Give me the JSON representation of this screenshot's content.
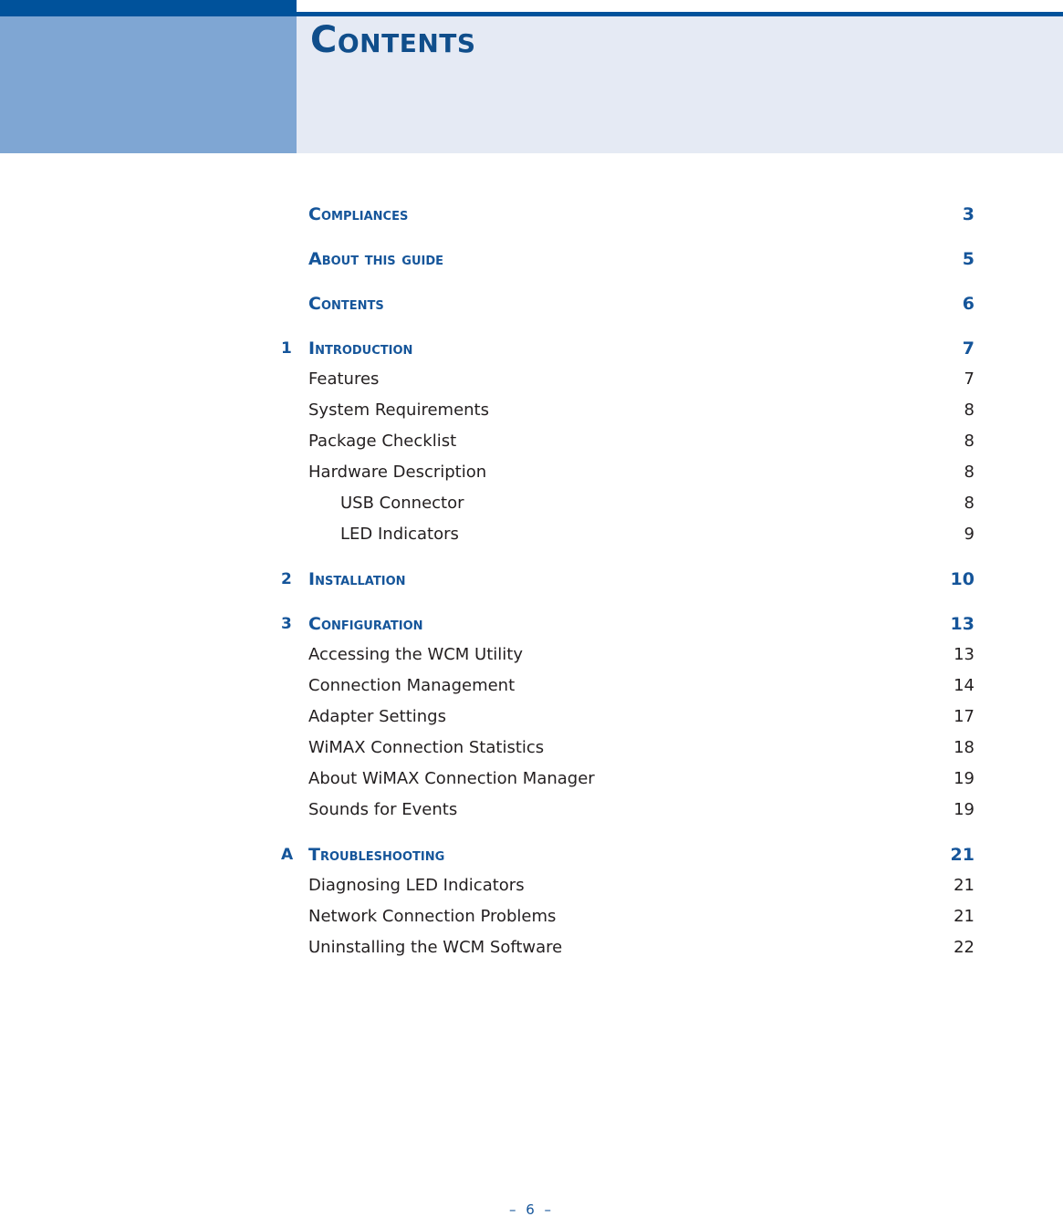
{
  "header": {
    "title": "CONTENTS",
    "dark_bar_color": "#00529B",
    "sidebar_color": "#7FA6D3",
    "panel_color": "#E5EAF4",
    "title_color": "#104E8B"
  },
  "toc": {
    "heading_color": "#15559A",
    "entry_color": "#231F20",
    "entries": [
      {
        "num": "",
        "label": "COMPLIANCES",
        "page": "3",
        "level": "front"
      },
      {
        "num": "",
        "label": "ABOUT THIS GUIDE",
        "page": "5",
        "level": "front"
      },
      {
        "num": "",
        "label": "CONTENTS",
        "page": "6",
        "level": "front"
      },
      {
        "num": "1",
        "label": "INTRODUCTION",
        "page": "7",
        "level": "chapter"
      },
      {
        "num": "",
        "label": "Features",
        "page": "7",
        "level": "1"
      },
      {
        "num": "",
        "label": "System Requirements",
        "page": "8",
        "level": "1"
      },
      {
        "num": "",
        "label": "Package Checklist",
        "page": "8",
        "level": "1"
      },
      {
        "num": "",
        "label": "Hardware Description",
        "page": "8",
        "level": "1"
      },
      {
        "num": "",
        "label": "USB Connector",
        "page": "8",
        "level": "2"
      },
      {
        "num": "",
        "label": "LED Indicators",
        "page": "9",
        "level": "2"
      },
      {
        "num": "2",
        "label": "INSTALLATION",
        "page": "10",
        "level": "chapter",
        "gap": true
      },
      {
        "num": "3",
        "label": "CONFIGURATION",
        "page": "13",
        "level": "chapter",
        "gap": true
      },
      {
        "num": "",
        "label": "Accessing the WCM Utility",
        "page": "13",
        "level": "1"
      },
      {
        "num": "",
        "label": "Connection Management",
        "page": "14",
        "level": "1"
      },
      {
        "num": "",
        "label": "Adapter Settings",
        "page": "17",
        "level": "1"
      },
      {
        "num": "",
        "label": "WiMAX Connection Statistics",
        "page": "18",
        "level": "1"
      },
      {
        "num": "",
        "label": "About WiMAX Connection Manager",
        "page": "19",
        "level": "1"
      },
      {
        "num": "",
        "label": "Sounds for Events",
        "page": "19",
        "level": "1"
      },
      {
        "num": "A",
        "label": "TROUBLESHOOTING",
        "page": "21",
        "level": "chapter",
        "gap": true
      },
      {
        "num": "",
        "label": "Diagnosing LED Indicators",
        "page": "21",
        "level": "1"
      },
      {
        "num": "",
        "label": "Network Connection Problems",
        "page": "21",
        "level": "1"
      },
      {
        "num": "",
        "label": "Uninstalling the WCM Software",
        "page": "22",
        "level": "1"
      }
    ]
  },
  "footer": {
    "page_label": "–  6  –"
  }
}
